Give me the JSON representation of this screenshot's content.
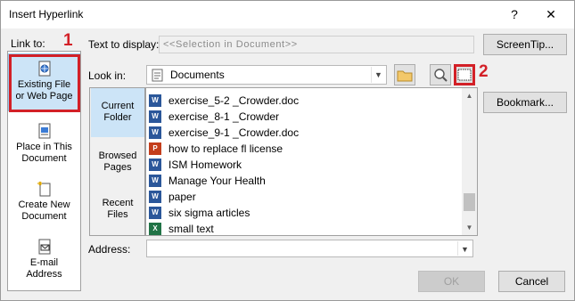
{
  "window": {
    "title": "Insert Hyperlink",
    "help": "?",
    "close": "✕"
  },
  "link_to": {
    "label": "Link to:",
    "marker": "1"
  },
  "nav": [
    {
      "label1": "Existing File",
      "label2": "or Web Page",
      "icon": "globe-document-icon"
    },
    {
      "label1": "Place in This",
      "label2": "Document",
      "icon": "document-place-icon"
    },
    {
      "label1": "Create New",
      "label2": "Document",
      "icon": "new-document-icon"
    },
    {
      "label1": "E-mail",
      "label2": "Address",
      "icon": "email-icon"
    }
  ],
  "text_to_display": {
    "label": "Text to display:",
    "value": "<<Selection in Document>>"
  },
  "screentip_button": "ScreenTip...",
  "look_in": {
    "label": "Look in:",
    "value": "Documents"
  },
  "browse_marker": "2",
  "bookmark_button": "Bookmark...",
  "folder_nav": [
    {
      "label1": "Current",
      "label2": "Folder"
    },
    {
      "label1": "Browsed",
      "label2": "Pages"
    },
    {
      "label1": "Recent",
      "label2": "Files"
    }
  ],
  "files": [
    {
      "name": "exercise_5-2 _Crowder.doc",
      "type": "W",
      "color": "#2b579a"
    },
    {
      "name": "exercise_8-1 _Crowder",
      "type": "W",
      "color": "#2b579a"
    },
    {
      "name": "exercise_9-1 _Crowder.doc",
      "type": "W",
      "color": "#2b579a"
    },
    {
      "name": "how to replace fl license",
      "type": "P",
      "color": "#c43e1c"
    },
    {
      "name": "ISM Homework",
      "type": "W",
      "color": "#2b579a"
    },
    {
      "name": "Manage Your Health",
      "type": "W",
      "color": "#2b579a"
    },
    {
      "name": "paper",
      "type": "W",
      "color": "#2b579a"
    },
    {
      "name": "six sigma articles",
      "type": "W",
      "color": "#2b579a"
    },
    {
      "name": "small text",
      "type": "X",
      "color": "#217346"
    }
  ],
  "address": {
    "label": "Address:",
    "value": ""
  },
  "ok_button": "OK",
  "cancel_button": "Cancel",
  "colors": {
    "accent_red": "#d32027",
    "selection": "#cce4f7"
  }
}
